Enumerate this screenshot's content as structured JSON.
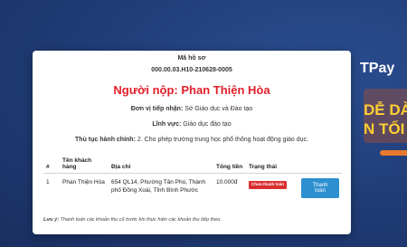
{
  "header": {
    "record_label": "Mã hồ sơ",
    "record_code": "000.00.03.H10-210628-0005"
  },
  "payer": {
    "text": "Người nộp: Phan Thiện Hòa"
  },
  "info": {
    "receiving_unit_label": "Đơn vị tiếp nhận:",
    "receiving_unit_value": "Sở Giáo dục và Đào tạo",
    "field_label": "Lĩnh vực:",
    "field_value": "Giáo dục đào tạo",
    "procedure_label": "Thủ tục hành chính:",
    "procedure_value": "2. Cho phép trường trung học phổ thông hoạt động giáo dục."
  },
  "table": {
    "headers": {
      "index": "#",
      "customer_name": "Tên khách hàng",
      "address": "Địa chỉ",
      "total": "Tổng tiền",
      "status": "Trạng thái"
    },
    "rows": [
      {
        "index": "1",
        "customer_name": "Phan Thiện Hòa",
        "address": "654 QL14, Phường Tân Phú, Thành phố Đồng Xoài, Tỉnh Bình Phước",
        "total": "10.000đ",
        "status": "Chưa thanh toán",
        "action": "Thanh toán"
      }
    ]
  },
  "note": {
    "label": "Lưu ý:",
    "text": "Thanh toán các khoản thu cũ trước khi thực hiện các khoản thu tiếp theo."
  },
  "background_banner": {
    "brand": "TPay",
    "line1": "DỄ DÀ",
    "line2": "N TỐI Ư"
  },
  "colors": {
    "backdrop": "#1f3a73",
    "payer_red": "#e0202a",
    "status_red": "#d9302f",
    "pay_blue": "#2d8fd0",
    "banner_yellow": "#ffcf33"
  }
}
